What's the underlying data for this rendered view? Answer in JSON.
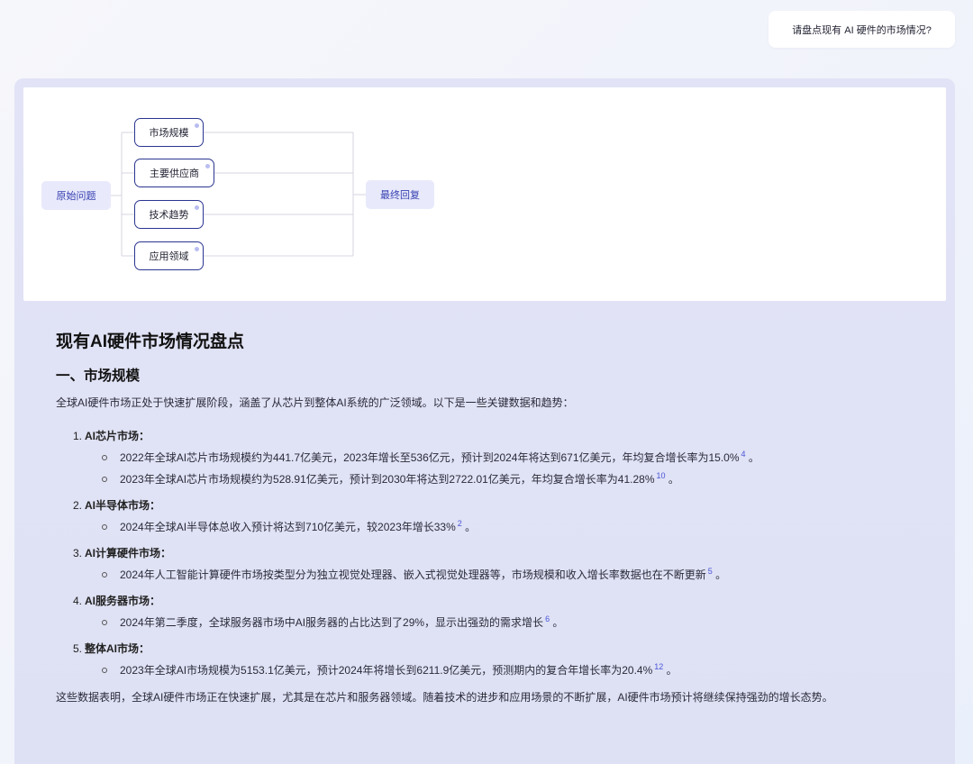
{
  "user_message": "请盘点现有 AI 硬件的市场情况?",
  "mindmap": {
    "root": "原始问题",
    "branches": [
      "市场规模",
      "主要供应商",
      "技术趋势",
      "应用领域"
    ],
    "final": "最终回复"
  },
  "answer": {
    "title": "现有AI硬件市场情况盘点",
    "section_title": "一、市场规模",
    "intro": "全球AI硬件市场正处于快速扩展阶段，涵盖了从芯片到整体AI系统的广泛领域。以下是一些关键数据和趋势：",
    "items": [
      {
        "num": "1.",
        "title": "AI芯片市场：",
        "bullets": [
          {
            "text": "2022年全球AI芯片市场规模约为441.7亿美元，2023年增长至536亿元，预计到2024年将达到671亿美元，年均复合增长率为15.0%",
            "cite": "4",
            "end": "。"
          },
          {
            "text": "2023年全球AI芯片市场规模约为528.91亿美元，预计到2030年将达到2722.01亿美元，年均复合增长率为41.28%",
            "cite": "10",
            "end": "。"
          }
        ]
      },
      {
        "num": "2.",
        "title": "AI半导体市场：",
        "bullets": [
          {
            "text": "2024年全球AI半导体总收入预计将达到710亿美元，较2023年增长33%",
            "cite": "2",
            "end": "。"
          }
        ]
      },
      {
        "num": "3.",
        "title": "AI计算硬件市场：",
        "bullets": [
          {
            "text": "2024年人工智能计算硬件市场按类型分为独立视觉处理器、嵌入式视觉处理器等，市场规模和收入增长率数据也在不断更新",
            "cite": "5",
            "end": "。"
          }
        ]
      },
      {
        "num": "4.",
        "title": "AI服务器市场：",
        "bullets": [
          {
            "text": "2024年第二季度，全球服务器市场中AI服务器的占比达到了29%，显示出强劲的需求增长",
            "cite": "6",
            "end": "。"
          }
        ]
      },
      {
        "num": "5.",
        "title": "整体AI市场：",
        "bullets": [
          {
            "text": "2023年全球AI市场规模为5153.1亿美元，预计2024年将增长到6211.9亿美元，预测期内的复合年增长率为20.4%",
            "cite": "12",
            "end": "。"
          }
        ]
      }
    ],
    "conclusion": "这些数据表明，全球AI硬件市场正在快速扩展，尤其是在芯片和服务器领域。随着技术的进步和应用场景的不断扩展，AI硬件市场预计将继续保持强劲的增长态势。"
  }
}
